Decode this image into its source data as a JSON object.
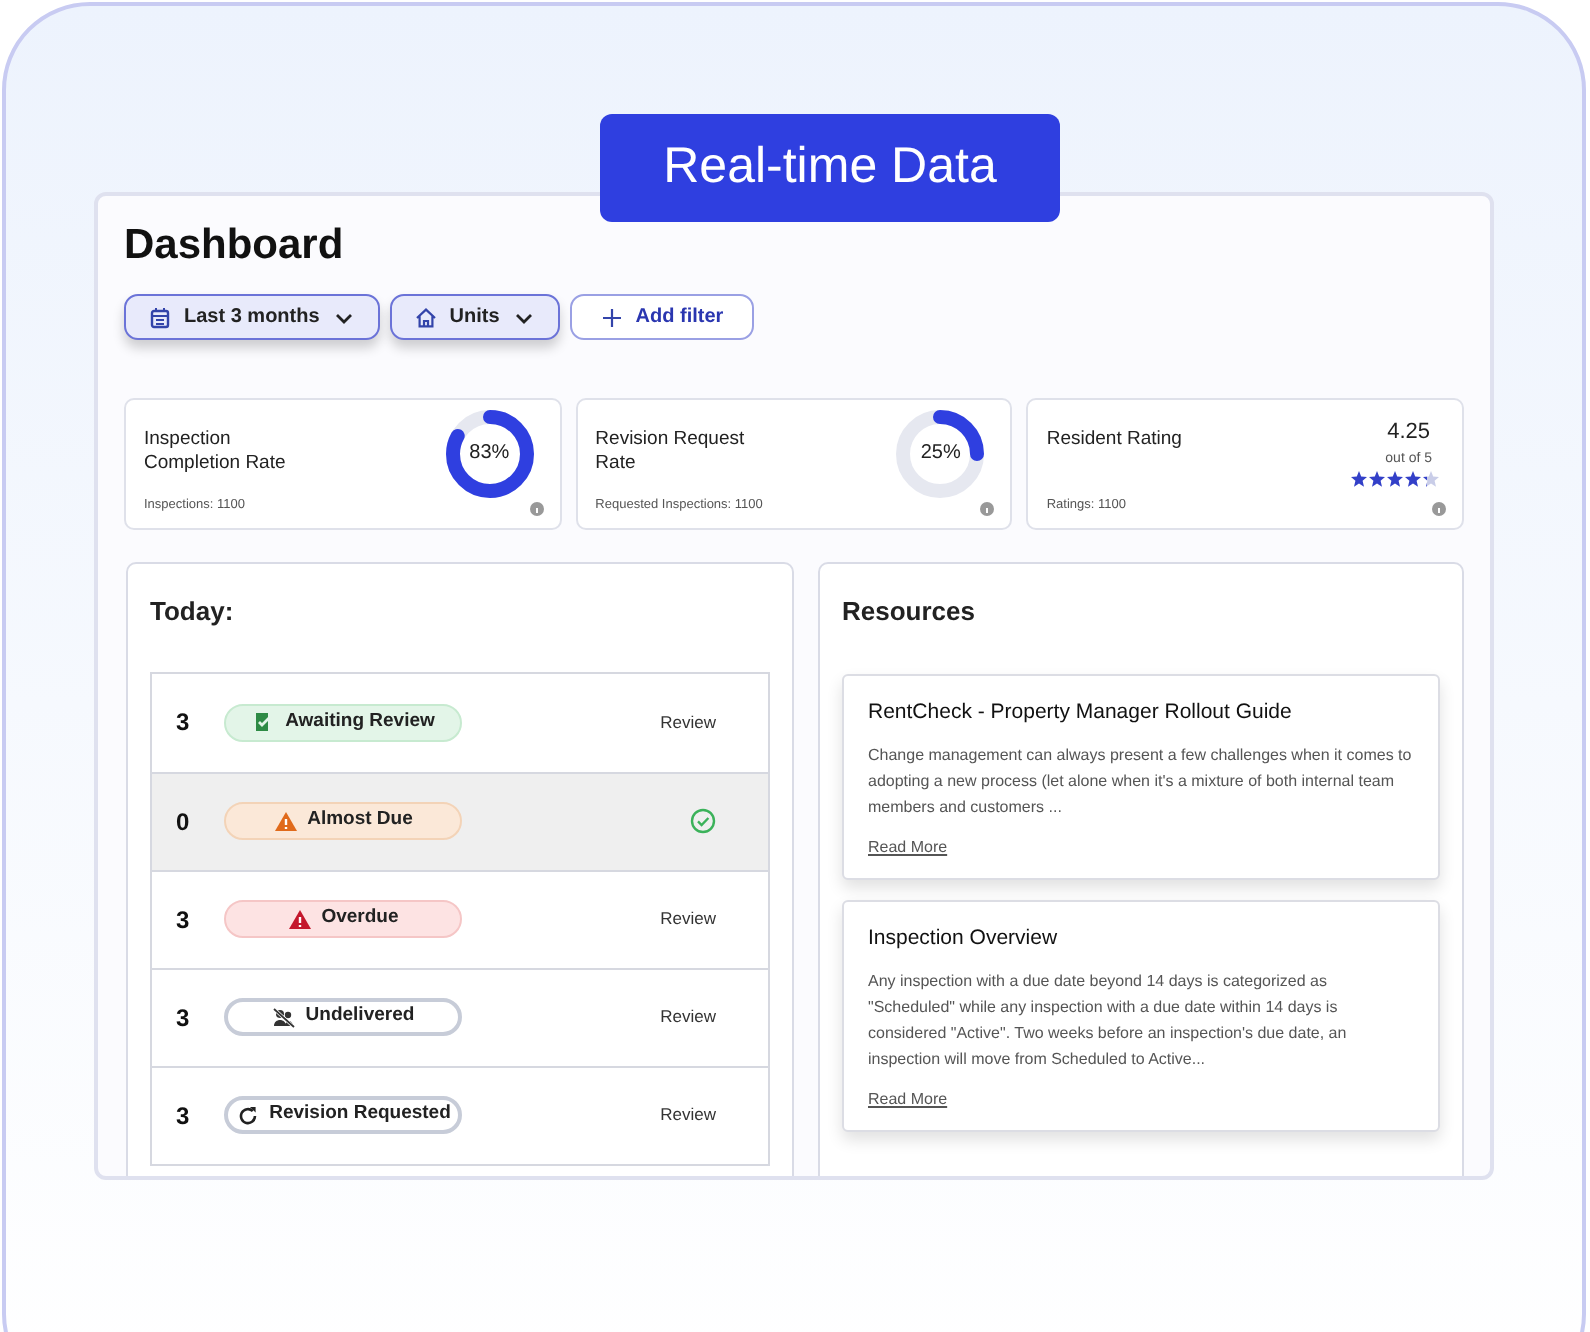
{
  "badge": "Real-time Data",
  "title": "Dashboard",
  "filters": [
    {
      "kind": "dropdown",
      "label": "Last 3 months"
    },
    {
      "kind": "dropdown",
      "label": "Units"
    },
    {
      "kind": "add",
      "label": "Add filter"
    }
  ],
  "stats": [
    {
      "kind": "donut",
      "title": "Inspection Completion Rate",
      "reading": "83%",
      "level": 0.83,
      "footer": "Inspections: 1100"
    },
    {
      "kind": "donut",
      "title": "Revision Request Rate",
      "reading": "25%",
      "level": 0.25,
      "footer": "Requested Inspections: 1100"
    },
    {
      "kind": "rating",
      "title": "Resident Rating",
      "reading": "4.25",
      "sub": "out of 5",
      "stars": 4.25,
      "footer": "Ratings: 1100"
    }
  ],
  "today": {
    "title": "Today:",
    "rows": [
      {
        "count": "3",
        "status": "Awaiting Review",
        "kind": "awaiting",
        "action": "Review",
        "done": false
      },
      {
        "count": "0",
        "status": "Almost Due",
        "kind": "almost",
        "done": true
      },
      {
        "count": "3",
        "status": "Overdue",
        "kind": "overdue",
        "action": "Review",
        "done": false
      },
      {
        "count": "3",
        "status": "Undelivered",
        "kind": "undelivered",
        "action": "Review",
        "done": false
      },
      {
        "count": "3",
        "status": "Revision Requested",
        "kind": "revision",
        "action": "Review",
        "done": false
      }
    ]
  },
  "resources": {
    "title": "Resources",
    "articles": [
      {
        "title": "RentCheck - Property Manager Rollout Guide",
        "text": "Change management can always present a few challenges when it comes to adopting a new process (let alone when it's a mixture of both internal team members and customers ...",
        "link": "Read More"
      },
      {
        "title": "Inspection Overview",
        "text": "Any inspection with a due date beyond 14 days is categorized as \"Scheduled\" while any inspection with a due date within 14 days is considered \"Active\". Two weeks before an inspection's due date, an inspection will move from Scheduled to Active...",
        "link": "Read More"
      }
    ]
  }
}
